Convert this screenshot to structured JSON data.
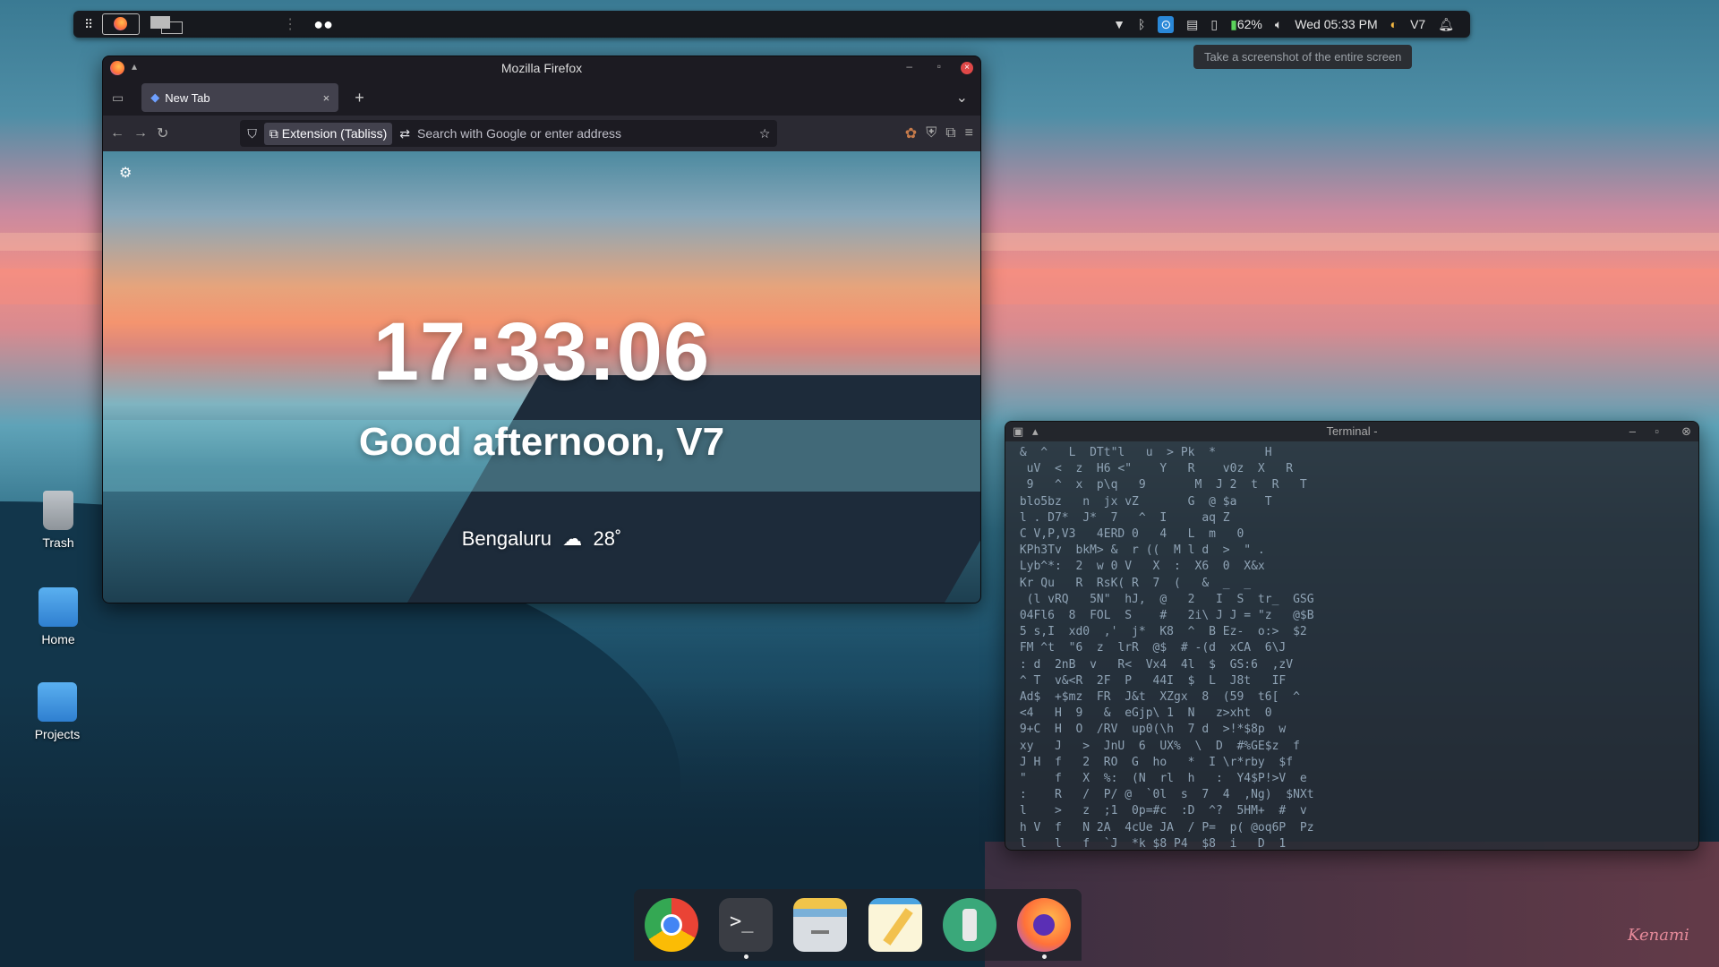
{
  "top_panel": {
    "apps_icon": "grid-icon",
    "status": {
      "battery": "62%",
      "datetime": "Wed 05:33 PM",
      "user": "V7"
    },
    "tooltip": "Take a screenshot of the entire screen"
  },
  "desktop_icons": [
    {
      "label": "Trash"
    },
    {
      "label": "Home"
    },
    {
      "label": "Projects"
    }
  ],
  "firefox": {
    "window_title": "Mozilla Firefox",
    "tab_label": "New Tab",
    "url_chip": "Extension (Tabliss)",
    "url_placeholder": "Search with Google or enter address",
    "clock": "17:33:06",
    "greeting": "Good afternoon, V7",
    "weather_city": "Bengaluru",
    "weather_temp": "28˚"
  },
  "terminal": {
    "title": "Terminal -",
    "lines": [
      " &  ^   L  DTt\"l   u  > Pk  *       H",
      "  uV  <  z  H6 <\"    Y   R    v0z  X   R",
      "  9   ^  x  p\\q   9       M  J 2  t  R   T",
      " blo5bz   n  jx vZ       G  @ $a    T",
      " l . D7*  J*  7   ^  I     aq Z        ",
      " C V,P,V3   4ERD 0   4   L  m   0",
      " KPh3Tv  bkM> &  r ((  M l d  >  \" .",
      " Lyb^*:  2  w 0 V   X  :  X6  0  X&x",
      " Kr Qu   R  RsK( R  7  (   &  _  _   ",
      "  (l vRQ   5N\"  hJ,  @   2   I  S  tr_  GSG",
      " 04Fl6  8  FOL  S    #   2i\\ J J = \"z   @$B",
      " 5 s,I  xd0  ,'  j*  K8  ^  B Ez-  o:>  $2",
      " FM ^t  \"6  z  lrR  @$  # -(d  xCA  6\\J",
      " : d  2nB  v   R<  Vx4  4l  $  GS:6  ,zV",
      " ^ T  v&<R  2F  P   44I  $  L  J8t   IF",
      " Ad$  +$mz  FR  J&t  XZgx  8  (59  t6[  ^",
      " <4   H  9   &  eGjp\\ 1  N   z>xht  0",
      " 9+C  H  O  /RV  up0(\\h  7 d  >!*$8p  w",
      " xy   J   >  JnU  6  UX%  \\  D  #%GE$z  f",
      " J H  f   2  RO  G  ho   *  I \\r*rby  $f",
      " \"    f   X  %:  (N  rl  h   :  Y4$P!>V  e",
      " :    R   /  P/ @  `0l  s  7  4  ,Ng)  $NXt",
      " l    >   z  ;1  0p=#c  :D  ^?  5HM+  #  v",
      " h V  f   N 2A  4cUe JA  / P=  p( @oq6P  Pz",
      " l    l   f  `J  *k $8 P4  $8  i   D  1"
    ]
  },
  "dock": [
    {
      "app": "Google Chrome"
    },
    {
      "app": "Terminal"
    },
    {
      "app": "Files"
    },
    {
      "app": "Text Editor"
    },
    {
      "app": "Tweaks"
    },
    {
      "app": "Firefox"
    }
  ],
  "watermark": "Kenami"
}
